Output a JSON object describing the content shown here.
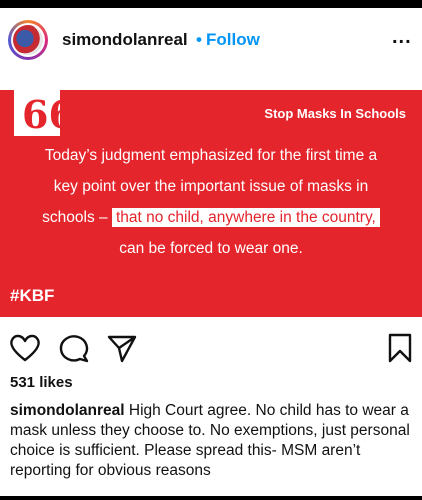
{
  "post": {
    "username": "simondolanreal",
    "separator": "•",
    "follow_label": "Follow",
    "more_label": "..."
  },
  "card": {
    "quote_mark": "66",
    "tag": "Stop Masks In Schools",
    "line1": "Today’s judgment emphasized for the first time a",
    "line2": "key point over the important issue of masks in",
    "line3_pre": "schools – ",
    "line3_highlight": "that no child, anywhere in the country,",
    "line4": "can be forced to wear one.",
    "hashtag": "#KBF"
  },
  "likes": "531 likes",
  "caption": {
    "username": "simondolanreal",
    "text": " High Court agree. No child has to wear a mask unless they choose to. No exemptions, just personal choice is sufficient. Please spread this- MSM aren’t reporting for obvious reasons"
  },
  "icons": [
    "heart-icon",
    "comment-icon",
    "share-icon",
    "bookmark-icon"
  ],
  "colors": {
    "card_red": "#e4252c",
    "follow_blue": "#0095f6"
  }
}
